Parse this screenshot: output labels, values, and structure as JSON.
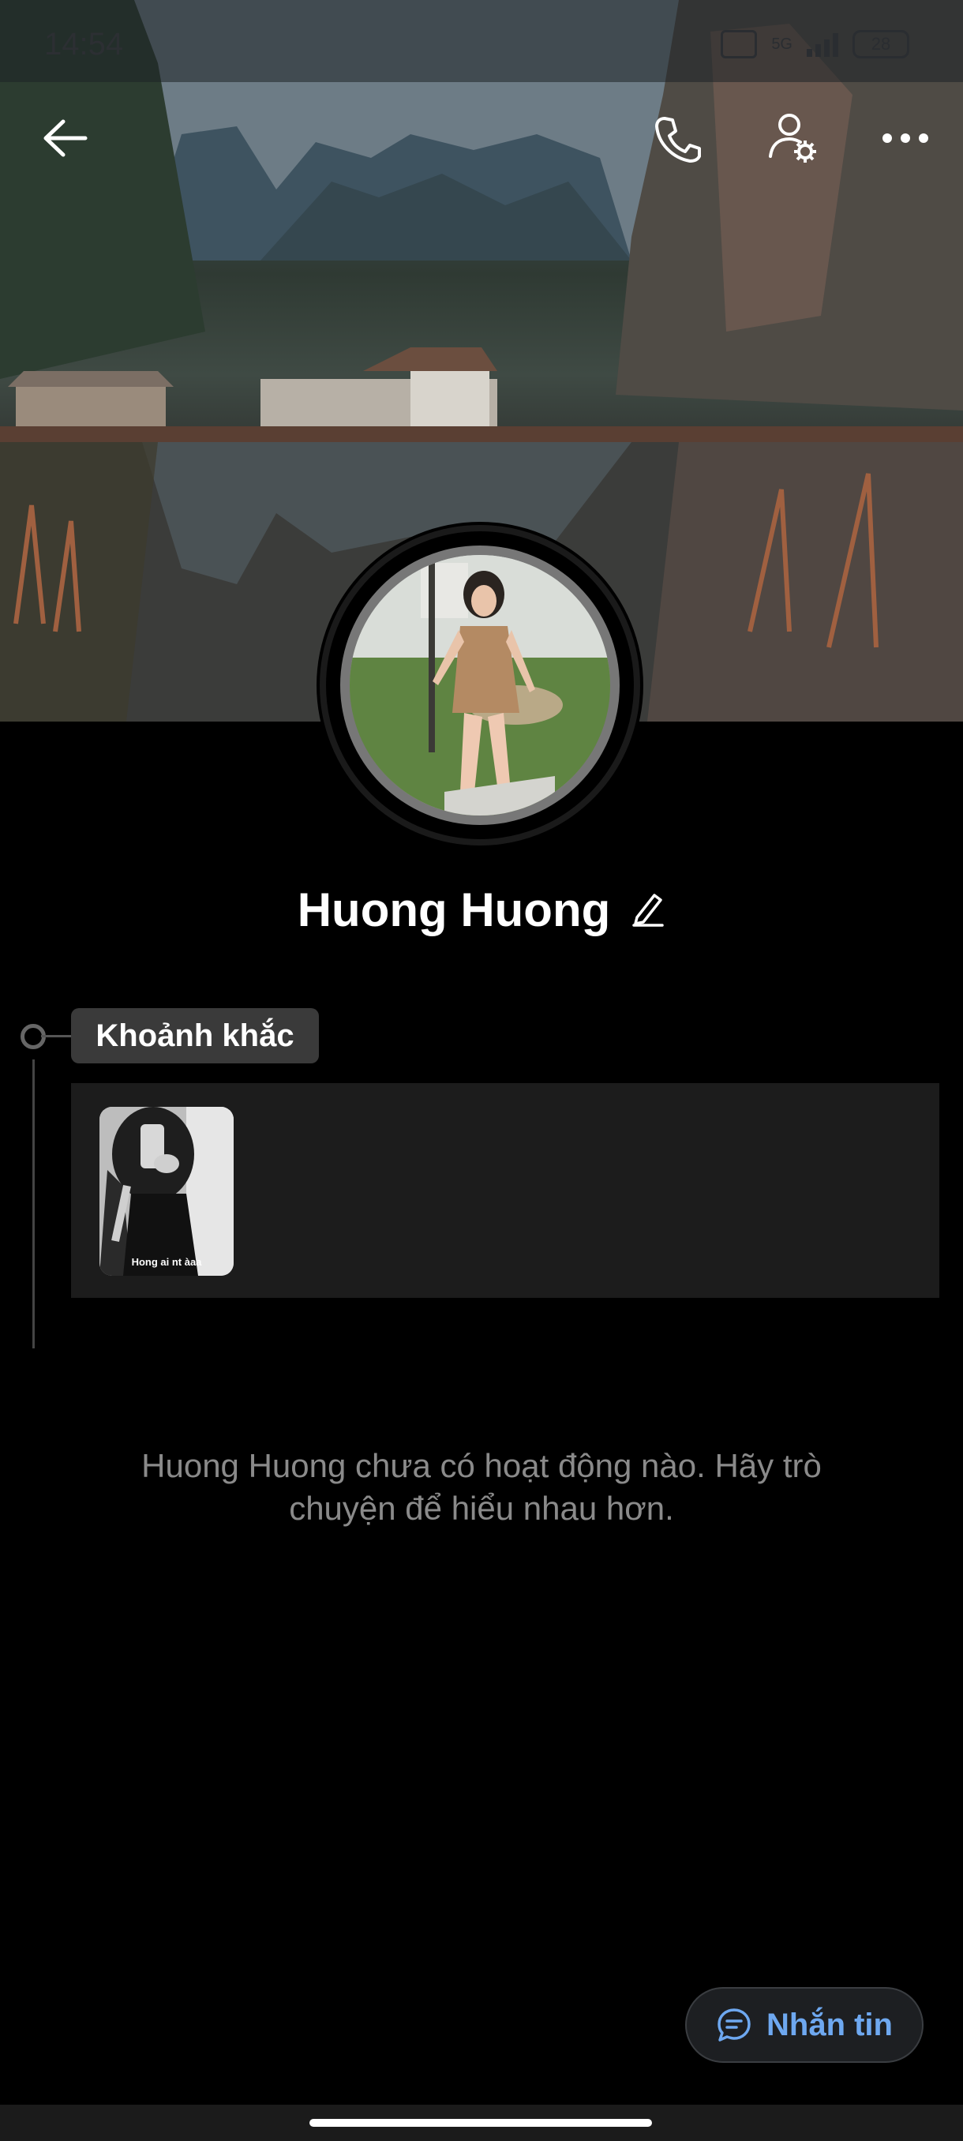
{
  "status_bar": {
    "time": "14:54",
    "network": "5G",
    "battery": "28"
  },
  "header": {
    "back_icon": "arrow-left-icon",
    "call_icon": "phone-icon",
    "settings_icon": "user-settings-icon",
    "more_icon": "more-horizontal-icon"
  },
  "profile": {
    "name": "Huong Huong",
    "edit_icon": "pencil-icon"
  },
  "moments": {
    "title": "Khoảnh khắc",
    "items": [
      {
        "caption": "Hong ai nt àaa"
      }
    ]
  },
  "empty_message": "Huong Huong chưa có hoạt động nào. Hãy trò chuyện để hiểu nhau hơn.",
  "actions": {
    "message_label": "Nhắn tin",
    "message_icon": "chat-bubble-icon"
  },
  "colors": {
    "background": "#000000",
    "accent": "#6ea8f0",
    "muted_text": "#8a8a8a"
  }
}
